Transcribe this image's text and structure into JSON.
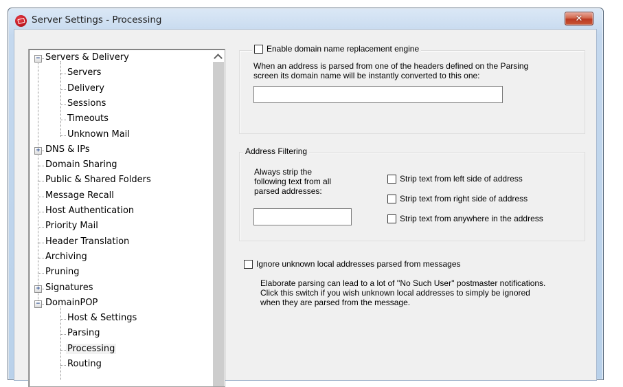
{
  "window": {
    "title": "Server Settings - Processing",
    "app_icon": "mdaemon-envelope-icon",
    "close_glyph": "✕"
  },
  "tree": {
    "scroll_up_glyph": "⌃",
    "items": [
      {
        "label": "Servers & Delivery",
        "level": 0,
        "expander": "−"
      },
      {
        "label": "Servers",
        "level": 1
      },
      {
        "label": "Delivery",
        "level": 1
      },
      {
        "label": "Sessions",
        "level": 1
      },
      {
        "label": "Timeouts",
        "level": 1
      },
      {
        "label": "Unknown Mail",
        "level": 1
      },
      {
        "label": "DNS & IPs",
        "level": 0,
        "expander": "+"
      },
      {
        "label": "Domain Sharing",
        "level": 0
      },
      {
        "label": "Public & Shared Folders",
        "level": 0
      },
      {
        "label": "Message Recall",
        "level": 0
      },
      {
        "label": "Host Authentication",
        "level": 0
      },
      {
        "label": "Priority Mail",
        "level": 0
      },
      {
        "label": "Header Translation",
        "level": 0
      },
      {
        "label": "Archiving",
        "level": 0
      },
      {
        "label": "Pruning",
        "level": 0
      },
      {
        "label": "Signatures",
        "level": 0,
        "expander": "+"
      },
      {
        "label": "DomainPOP",
        "level": 0,
        "expander": "−"
      },
      {
        "label": "Host & Settings",
        "level": 1
      },
      {
        "label": "Parsing",
        "level": 1
      },
      {
        "label": "Processing",
        "level": 1,
        "selected": true
      },
      {
        "label": "Routing",
        "level": 1
      }
    ]
  },
  "domain_replacement": {
    "checkbox_label": "Enable domain name replacement engine",
    "checked": false,
    "description_line1": "When an address is parsed from one of the headers defined on the Parsing",
    "description_line2": "screen its domain name will be instantly converted to this one:",
    "input_value": "",
    "input_placeholder": ""
  },
  "address_filtering": {
    "legend": "Address Filtering",
    "strip_label_line1": "Always strip the",
    "strip_label_line2": "following text from all",
    "strip_label_line3": "parsed addresses:",
    "strip_input_value": "",
    "options": [
      {
        "label": "Strip text from left side of address",
        "checked": false
      },
      {
        "label": "Strip text from right side of address",
        "checked": false
      },
      {
        "label": "Strip text from anywhere in the address",
        "checked": false
      }
    ]
  },
  "ignore_unknown": {
    "checkbox_label": "Ignore unknown local addresses parsed from messages",
    "checked": false,
    "description_line1": "Elaborate parsing can lead to a lot of ''No Such User'' postmaster notifications.",
    "description_line2": "Click this switch if you wish unknown local addresses to simply be ignored",
    "description_line3": "when they are parsed from the message."
  }
}
